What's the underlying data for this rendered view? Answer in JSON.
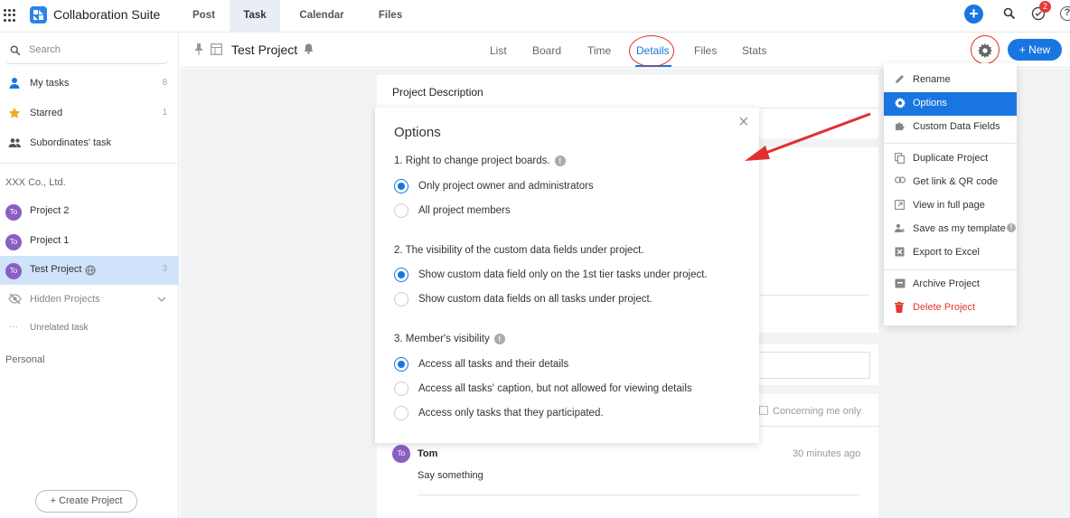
{
  "app": {
    "title": "Collaboration Suite",
    "brand_color": "#2a84e8",
    "accent_color": "#1976e0",
    "nav_tabs": [
      {
        "label": "Post",
        "active": false
      },
      {
        "label": "Task",
        "active": true
      },
      {
        "label": "Calendar",
        "active": false
      },
      {
        "label": "Files",
        "active": false
      }
    ],
    "notification_count": "2",
    "icons": [
      "apps-grid-icon",
      "plus-icon",
      "search-icon",
      "check-circle-icon",
      "help-icon"
    ]
  },
  "sidebar": {
    "search_placeholder": "Search",
    "items": [
      {
        "label": "My tasks",
        "count": "8",
        "icon": "person-icon"
      },
      {
        "label": "Starred",
        "count": "1",
        "icon": "star-icon"
      },
      {
        "label": "Subordinates' task",
        "count": "",
        "icon": "group-icon"
      }
    ],
    "org_label": "XXX Co., Ltd.",
    "projects": [
      {
        "avatar": "To",
        "label": "Project 2",
        "count": ""
      },
      {
        "avatar": "To",
        "label": "Project 1",
        "count": ""
      },
      {
        "avatar": "To",
        "label": "Test Project",
        "count": "3",
        "selected": true
      }
    ],
    "hidden_projects": "Hidden Projects",
    "unrelated_task": "Unrelated task",
    "personal_label": "Personal",
    "create_project": "+ Create Project"
  },
  "project_header": {
    "title": "Test Project",
    "tabs": [
      {
        "label": "List",
        "active": false
      },
      {
        "label": "Board",
        "active": false
      },
      {
        "label": "Time",
        "active": false
      },
      {
        "label": "Details",
        "active": true
      },
      {
        "label": "Files",
        "active": false
      },
      {
        "label": "Stats",
        "active": false
      }
    ],
    "new_button": "+ New"
  },
  "details": {
    "description_title": "Project Description",
    "concerning_me_only": "Concerning me only",
    "comment": {
      "avatar": "To",
      "author": "Tom",
      "time": "30 minutes ago",
      "text": "Say something"
    }
  },
  "options_modal": {
    "title": "Options",
    "close": "×",
    "sections": [
      {
        "question": "1. Right to change project boards.",
        "has_info": true,
        "options": [
          {
            "label": "Only project owner and administrators",
            "selected": true
          },
          {
            "label": "All project members",
            "selected": false
          }
        ]
      },
      {
        "question": "2. The visibility of the custom data fields under project.",
        "has_info": false,
        "options": [
          {
            "label": "Show custom data field only on the 1st tier tasks under project.",
            "selected": true
          },
          {
            "label": "Show custom data fields on all tasks under project.",
            "selected": false
          }
        ]
      },
      {
        "question": "3. Member's visibility",
        "has_info": true,
        "options": [
          {
            "label": "Access all tasks and their details",
            "selected": true
          },
          {
            "label": "Access all tasks' caption, but not allowed for viewing details",
            "selected": false
          },
          {
            "label": "Access only tasks that they participated.",
            "selected": false
          }
        ]
      }
    ]
  },
  "settings_menu": {
    "items": [
      {
        "label": "Rename",
        "icon": "pencil-icon"
      },
      {
        "label": "Options",
        "icon": "gear-icon",
        "active": true
      },
      {
        "label": "Custom Data Fields",
        "icon": "puzzle-icon"
      },
      {
        "label": "Duplicate Project",
        "icon": "copy-icon"
      },
      {
        "label": "Get link & QR code",
        "icon": "link-icon"
      },
      {
        "label": "View in full page",
        "icon": "expand-icon"
      },
      {
        "label": "Save as my template",
        "icon": "template-icon",
        "has_info": true
      },
      {
        "label": "Export to Excel",
        "icon": "excel-icon"
      },
      {
        "label": "Archive Project",
        "icon": "archive-icon"
      },
      {
        "label": "Delete Project",
        "icon": "trash-icon",
        "danger": true
      }
    ]
  },
  "annotation_color": "#e03030"
}
